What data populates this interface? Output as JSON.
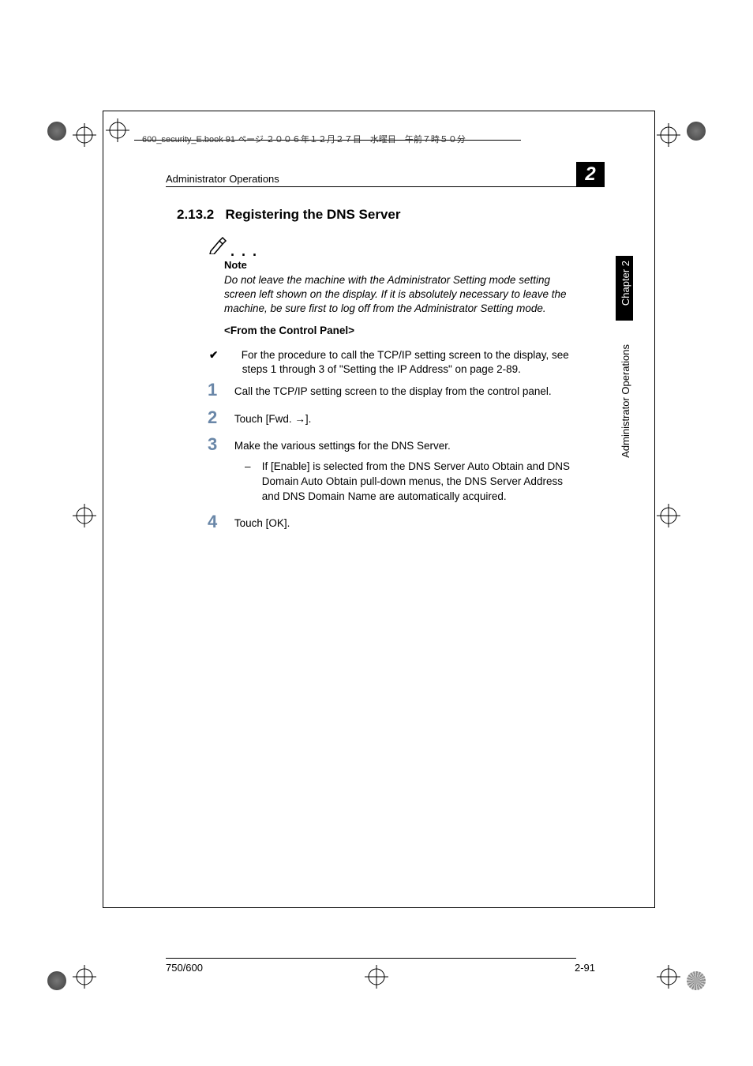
{
  "header_meta": "600_security_E.book  91 ページ  ２００６年１２月２７日　水曜日　午前７時５０分",
  "running_head": "Administrator Operations",
  "chapter_number": "2",
  "section": {
    "number": "2.13.2",
    "title": "Registering the DNS Server"
  },
  "note": {
    "label": "Note",
    "body": "Do not leave the machine with the Administrator Setting mode setting screen left shown on the display. If it is absolutely necessary to leave the machine, be sure first to log off from the Administrator Setting mode."
  },
  "subheading": "<From the Control Panel>",
  "check_item": "For the procedure to call the TCP/IP setting screen to the display, see steps 1 through 3 of \"Setting the IP Address\" on page 2-89.",
  "steps": [
    {
      "num": "1",
      "text": "Call the TCP/IP setting screen to the display from the control panel."
    },
    {
      "num": "2",
      "text": "Touch [Fwd. →]."
    },
    {
      "num": "3",
      "text": "Make the various settings for the DNS Server."
    },
    {
      "num": "4",
      "text": "Touch [OK]."
    }
  ],
  "sub_bullet": "If [Enable] is selected from the DNS Server Auto Obtain and DNS Domain Auto Obtain pull-down menus, the DNS Server Address and DNS Domain Name are automatically acquired.",
  "footer": {
    "left": "750/600",
    "right": "2-91"
  },
  "side": {
    "chapter": "Chapter 2",
    "section": "Administrator Operations"
  }
}
